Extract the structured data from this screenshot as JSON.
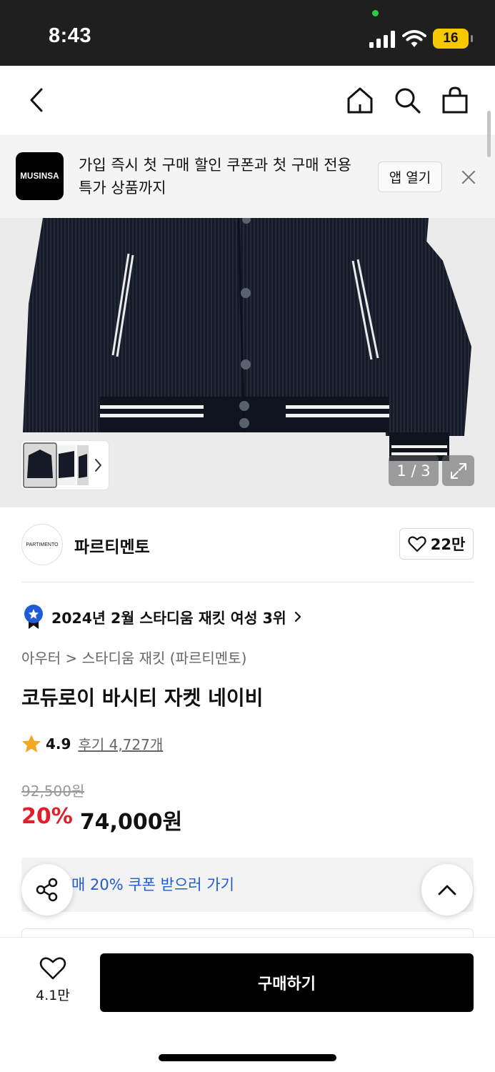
{
  "status": {
    "time": "8:43",
    "battery": "16"
  },
  "nav": {
    "back": "back-icon",
    "home": "home-icon",
    "search": "search-icon",
    "cart": "bag-icon"
  },
  "banner": {
    "logo_text": "MUSINSA",
    "message": "가입 즉시 첫 구매 할인 쿠폰과 첫 구매 전용 특가 상품까지",
    "open_label": "앱 열기"
  },
  "gallery": {
    "counter": "1 / 3"
  },
  "brand": {
    "logo_text": "PARTIMENTO",
    "name": "파르티멘토",
    "likes": "22만"
  },
  "product": {
    "rank_text": "2024년 2월 스타디움 재킷 여성 3위",
    "category": "아우터 > 스타디움 재킷 (파르티멘토)",
    "title": "코듀로이 바시티 자켓 네이비",
    "rating": "4.9",
    "reviews": "후기 4,727개",
    "original_price": "92,500원",
    "discount": "20%",
    "sale_price": "74,000원"
  },
  "coupon": {
    "text": "매 20% 쿠폰 받으러 가기"
  },
  "bottom": {
    "wish_count": "4.1만",
    "buy_label": "구매하기"
  },
  "colors": {
    "discount": "#e01f2a",
    "coupon": "#1f5bd6",
    "rank_badge": "#1f5bd6",
    "star": "#f5a623"
  }
}
